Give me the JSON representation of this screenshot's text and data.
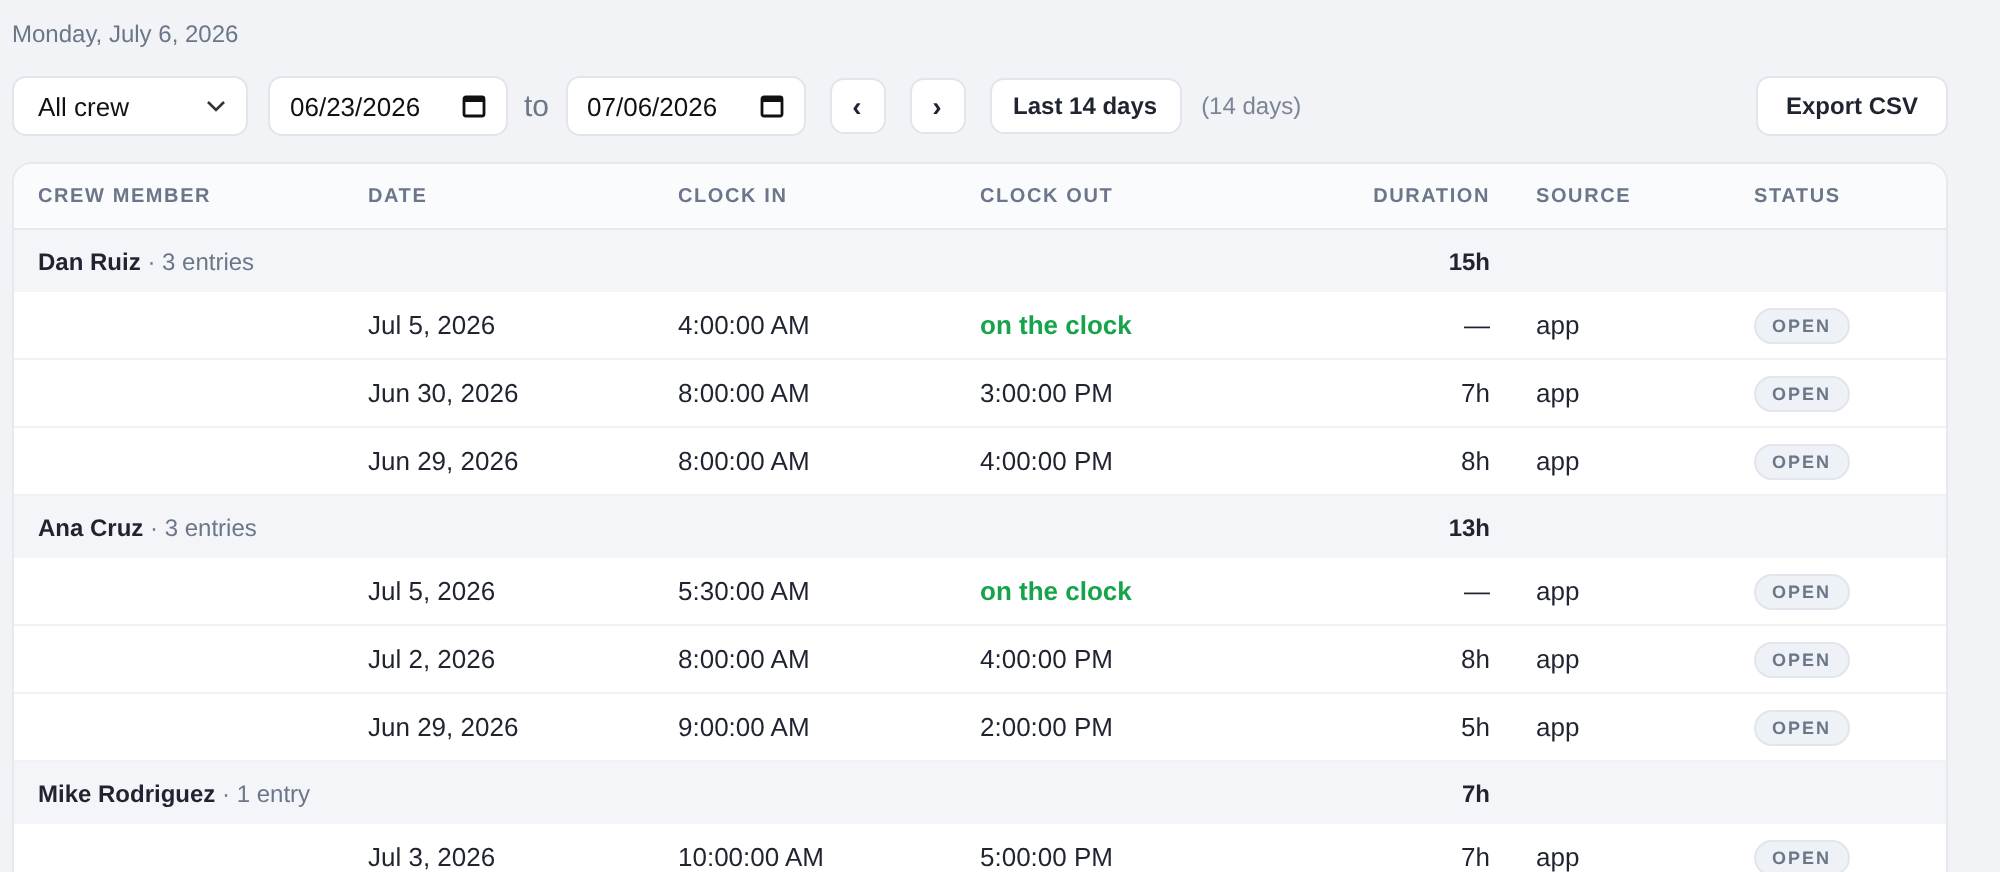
{
  "date_heading": "Monday, July 6, 2026",
  "filters": {
    "crew_select": "All crew",
    "from_date": "06/23/2026",
    "to_label": "to",
    "to_date": "07/06/2026",
    "prev": "‹",
    "next": "›",
    "preset": "Last 14 days",
    "span": "(14 days)",
    "export": "Export CSV"
  },
  "table": {
    "columns": [
      "CREW MEMBER",
      "DATE",
      "CLOCK IN",
      "CLOCK OUT",
      "DURATION",
      "SOURCE",
      "STATUS"
    ],
    "groups": [
      {
        "name": "Dan Ruiz",
        "count": "· 3 entries",
        "total": "15h",
        "entries": [
          {
            "date": "Jul 5, 2026",
            "clock_in": "4:00:00 AM",
            "clock_out": "on the clock",
            "on_clock": true,
            "duration": "—",
            "source": "app",
            "status": "OPEN"
          },
          {
            "date": "Jun 30, 2026",
            "clock_in": "8:00:00 AM",
            "clock_out": "3:00:00 PM",
            "on_clock": false,
            "duration": "7h",
            "source": "app",
            "status": "OPEN"
          },
          {
            "date": "Jun 29, 2026",
            "clock_in": "8:00:00 AM",
            "clock_out": "4:00:00 PM",
            "on_clock": false,
            "duration": "8h",
            "source": "app",
            "status": "OPEN"
          }
        ]
      },
      {
        "name": "Ana Cruz",
        "count": "· 3 entries",
        "total": "13h",
        "entries": [
          {
            "date": "Jul 5, 2026",
            "clock_in": "5:30:00 AM",
            "clock_out": "on the clock",
            "on_clock": true,
            "duration": "—",
            "source": "app",
            "status": "OPEN"
          },
          {
            "date": "Jul 2, 2026",
            "clock_in": "8:00:00 AM",
            "clock_out": "4:00:00 PM",
            "on_clock": false,
            "duration": "8h",
            "source": "app",
            "status": "OPEN"
          },
          {
            "date": "Jun 29, 2026",
            "clock_in": "9:00:00 AM",
            "clock_out": "2:00:00 PM",
            "on_clock": false,
            "duration": "5h",
            "source": "app",
            "status": "OPEN"
          }
        ]
      },
      {
        "name": "Mike Rodriguez",
        "count": "· 1 entry",
        "total": "7h",
        "entries": [
          {
            "date": "Jul 3, 2026",
            "clock_in": "10:00:00 AM",
            "clock_out": "5:00:00 PM",
            "on_clock": false,
            "duration": "7h",
            "source": "app",
            "status": "OPEN"
          }
        ]
      }
    ]
  }
}
